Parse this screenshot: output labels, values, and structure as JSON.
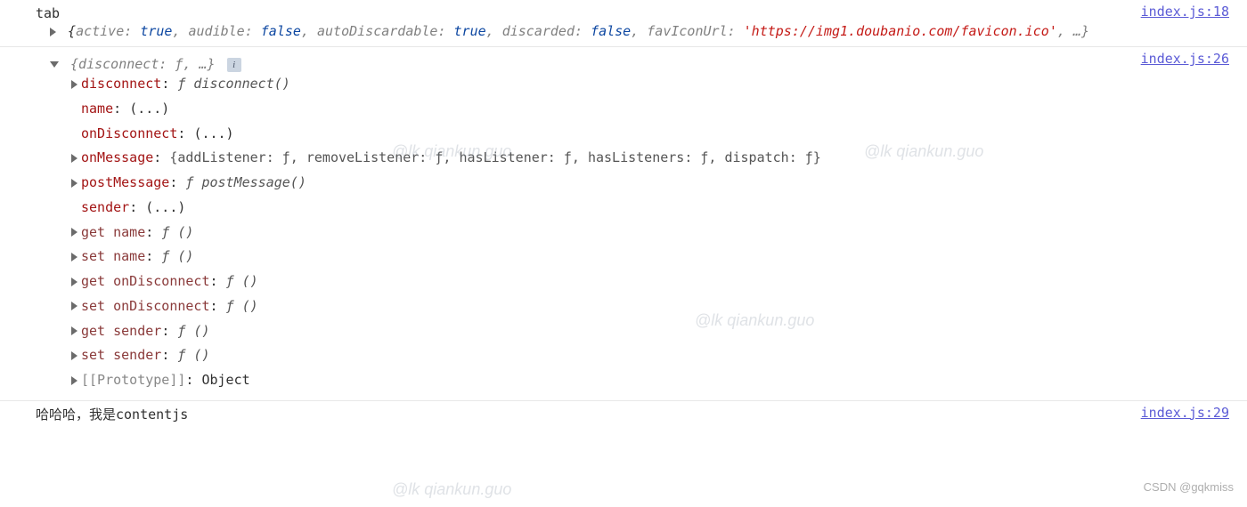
{
  "watermark": "@lk qiankun.guo",
  "csdn_watermark": "CSDN @gqkmiss",
  "entries": [
    {
      "source": "index.js:18",
      "label": "tab",
      "summary_parts": {
        "open": "{",
        "k1": "active",
        "v1": "true",
        "k2": "audible",
        "v2": "false",
        "k3": "autoDiscardable",
        "v3": "true",
        "k4": "discarded",
        "v4": "false",
        "k5": "favIconUrl",
        "v5": "'https://img1.doubanio.com/favicon.ico'",
        "ellipsis": ", …}",
        "sep": ": ",
        "comma": ", "
      }
    },
    {
      "source": "index.js:26",
      "summary": "{disconnect: ƒ, …}",
      "info": "i",
      "props": [
        {
          "arrow": true,
          "key": "disconnect",
          "val_i": "ƒ disconnect()"
        },
        {
          "arrow": false,
          "key": "name",
          "val": "(...)"
        },
        {
          "arrow": false,
          "key": "onDisconnect",
          "val": "(...)"
        },
        {
          "arrow": true,
          "key": "onMessage",
          "val_raw": "{addListener: ƒ, removeListener: ƒ, hasListener: ƒ, hasListeners: ƒ, dispatch: ƒ}"
        },
        {
          "arrow": true,
          "key": "postMessage",
          "val_i": "ƒ postMessage()"
        },
        {
          "arrow": false,
          "key": "sender",
          "val": "(...)"
        },
        {
          "arrow": true,
          "key_faded": "get name",
          "val_i": "ƒ ()"
        },
        {
          "arrow": true,
          "key_faded": "set name",
          "val_i": "ƒ ()"
        },
        {
          "arrow": true,
          "key_faded": "get onDisconnect",
          "val_i": "ƒ ()"
        },
        {
          "arrow": true,
          "key_faded": "set onDisconnect",
          "val_i": "ƒ ()"
        },
        {
          "arrow": true,
          "key_faded": "get sender",
          "val_i": "ƒ ()"
        },
        {
          "arrow": true,
          "key_faded": "set sender",
          "val_i": "ƒ ()"
        },
        {
          "arrow": true,
          "key_proto": "[[Prototype]]",
          "val": "Object"
        }
      ]
    },
    {
      "source": "index.js:29",
      "message": "哈哈哈，我是contentjs"
    }
  ]
}
